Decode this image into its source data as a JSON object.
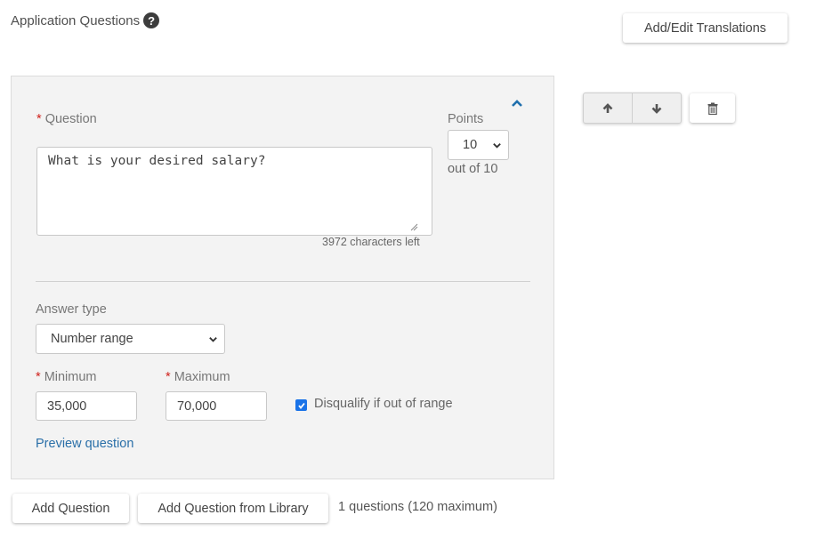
{
  "header": {
    "title": "Application Questions",
    "help_icon": "question-circle-icon",
    "translations_button": "Add/Edit Translations"
  },
  "question_card": {
    "required_marker": "*",
    "question_label": "Question",
    "question_value": "What is your desired salary?",
    "chars_left": "3972 characters left",
    "points_label": "Points",
    "points_value": "10",
    "points_out_of": "out of 10",
    "collapse_icon": "chevron-up-icon",
    "answer_type_label": "Answer type",
    "answer_type_value": "Number range",
    "minimum_label": "Minimum",
    "minimum_value": "35,000",
    "maximum_label": "Maximum",
    "maximum_value": "70,000",
    "disqualify_label": "Disqualify if out of range",
    "disqualify_checked": true,
    "preview_link": "Preview question"
  },
  "card_actions": {
    "move_up_icon": "arrow-up-icon",
    "move_down_icon": "arrow-down-icon",
    "delete_icon": "trash-icon"
  },
  "footer": {
    "add_question": "Add Question",
    "add_from_library": "Add Question from Library",
    "count_text": "1 questions (120 maximum)"
  },
  "colors": {
    "accent": "#1a73e8",
    "link": "#2a6fa8",
    "required": "#d0211c",
    "panel_bg": "#f3f3f3"
  }
}
